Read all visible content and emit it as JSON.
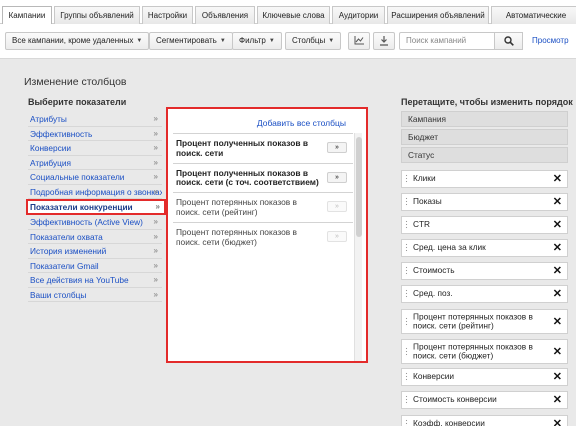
{
  "tabs": [
    "Кампании",
    "Группы объявлений",
    "Настройки",
    "Объявления",
    "Ключевые слова",
    "Аудитории",
    "Расширения объявлений",
    "Автоматические"
  ],
  "toolbar": {
    "campaign_filter": "Все кампании, кроме удаленных",
    "segment": "Сегментировать",
    "filter": "Фильтр",
    "columns": "Столбцы",
    "chart_icon": "line-chart-icon",
    "download_icon": "download-icon",
    "search_placeholder": "Поиск кампаний",
    "search_icon": "search-icon",
    "view_link": "Просмотр"
  },
  "panel": {
    "title": "Изменение столбцов",
    "left_heading": "Выберите показатели",
    "right_heading": "Перетащите, чтобы изменить порядок",
    "chevron": "»"
  },
  "categories": [
    "Атрибуты",
    "Эффективность",
    "Конверсии",
    "Атрибуция",
    "Социальные показатели",
    "Подробная информация о звонках",
    "Показатели конкуренции",
    "Эффективность (Active View)",
    "Показатели охвата",
    "История изменений",
    "Показатели Gmail",
    "Все действия на YouTube",
    "Ваши столбцы"
  ],
  "selected_category_index": 6,
  "metrics": {
    "add_all": "Добавить все столбцы",
    "add_button": "»",
    "items": [
      {
        "label": "Процент полученных показов в поиск. сети",
        "enabled": true
      },
      {
        "label": "Процент полученных показов в поиск. сети (с точ. соответствием)",
        "enabled": true
      },
      {
        "label": "Процент потерянных показов в поиск. сети (рейтинг)",
        "enabled": false
      },
      {
        "label": "Процент потерянных показов в поиск. сети (бюджет)",
        "enabled": false
      }
    ]
  },
  "fixed_columns": [
    "Кампания",
    "Бюджет",
    "Статус"
  ],
  "selected_columns": {
    "remove": "✕",
    "items": [
      "Клики",
      "Показы",
      "CTR",
      "Сред. цена за клик",
      "Стоимость",
      "Сред. поз.",
      "Процент потерянных показов в поиск. сети (рейтинг)",
      "Процент потерянных показов в поиск. сети (бюджет)",
      "Конверсии",
      "Стоимость конверсии",
      "Коэфф. конверсии"
    ]
  },
  "colors": {
    "highlight": "#e32b2b",
    "link": "#1a4fc4",
    "panel_bg": "#e9e9e9"
  }
}
